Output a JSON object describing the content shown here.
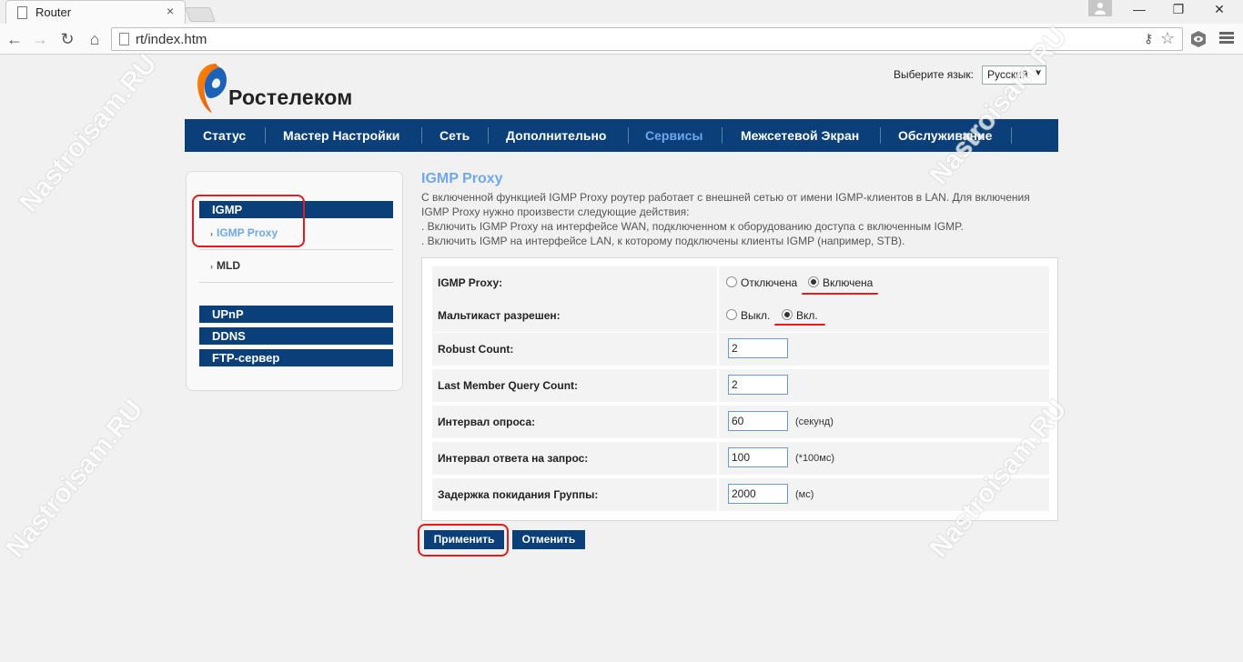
{
  "browser": {
    "tab_title": "Router",
    "tab_close": "×",
    "url": "rt/index.htm",
    "win_minimize": "—",
    "win_restore": "❐",
    "win_close": "✕",
    "back": "←",
    "forward": "→",
    "reload": "↻",
    "home": "⌂",
    "star": "☆",
    "key": "⚷"
  },
  "header": {
    "logo_text": "Ростелеком",
    "lang_label": "Выберите язык:",
    "lang_value": "Русский",
    "lang_arrow": "▼"
  },
  "nav": [
    {
      "label": "Статус"
    },
    {
      "label": "Мастер Настройки"
    },
    {
      "label": "Сеть"
    },
    {
      "label": "Дополнительно"
    },
    {
      "label": "Сервисы"
    },
    {
      "label": "Межсетевой Экран"
    },
    {
      "label": "Обслуживание"
    }
  ],
  "sidebar": {
    "igmp": "IGMP",
    "igmp_proxy": "IGMP Proxy",
    "mld": "MLD",
    "upnp": "UPnP",
    "ddns": "DDNS",
    "ftp": "FTP-сервер",
    "bullet": "›"
  },
  "content": {
    "title": "IGMP Proxy",
    "desc_lines": [
      "С включенной функцией IGMP Proxy роутер работает с внешней сетью от имени IGMP-клиентов в LAN. Для включения",
      "IGMP Proxy нужно произвести следующие действия:",
      ". Включить IGMP Proxy на интерфейсе WAN, подключенном к оборудованию доступа с включенным IGMP.",
      ". Включить IGMP на интерфейсе LAN, к которому подключены клиенты IGMP (например, STB)."
    ]
  },
  "form": {
    "igmp_proxy": {
      "label": "IGMP Proxy:",
      "off": "Отключена",
      "on": "Включена",
      "selected": "on"
    },
    "multicast": {
      "label": "Мальтикаст разрешен:",
      "off": "Выкл.",
      "on": "Вкл.",
      "selected": "on"
    },
    "robust": {
      "label": "Robust Count:",
      "value": "2"
    },
    "last_member": {
      "label": "Last Member Query Count:",
      "value": "2"
    },
    "query_interval": {
      "label": "Интервал опроса:",
      "value": "60",
      "unit": "(секунд)"
    },
    "response_interval": {
      "label": "Интервал ответа на запрос:",
      "value": "100",
      "unit": "(*100мс)"
    },
    "group_leave": {
      "label": "Задержка покидания Группы:",
      "value": "2000",
      "unit": "(мс)"
    }
  },
  "buttons": {
    "apply": "Применить",
    "cancel": "Отменить"
  },
  "watermark": "Nastroisam.RU",
  "colors": {
    "nav_bg": "#0a3f7a",
    "active_link": "#6fa8ec",
    "highlight": "#e01c1c"
  }
}
